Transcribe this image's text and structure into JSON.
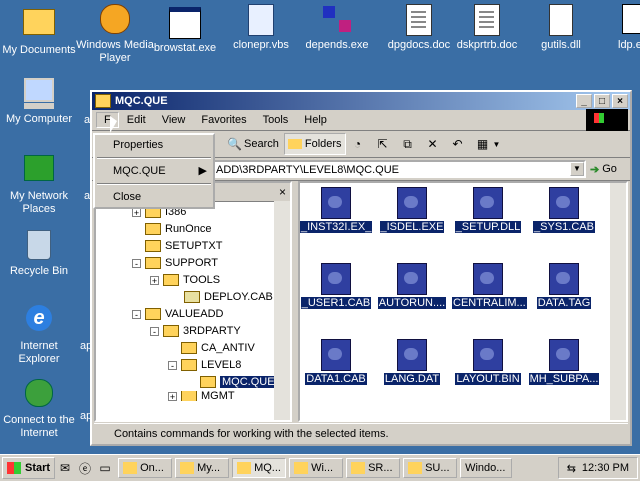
{
  "desktop": {
    "icons": [
      {
        "label": "My Documents",
        "icon": "folder-documents-icon"
      },
      {
        "label": "Windows Media Player",
        "icon": "media-player-icon"
      },
      {
        "label": "browstat.exe",
        "icon": "exe-icon"
      },
      {
        "label": "clonepr.vbs",
        "icon": "script-icon"
      },
      {
        "label": "depends.exe",
        "icon": "exe-icon"
      },
      {
        "label": "dpgdocs.doc",
        "icon": "doc-icon"
      },
      {
        "label": "dskprtrb.doc",
        "icon": "doc-icon"
      },
      {
        "label": "gutils.dll",
        "icon": "dll-icon"
      },
      {
        "label": "ldp.e",
        "icon": "exe-icon"
      },
      {
        "label": "My Computer",
        "icon": "computer-icon"
      },
      {
        "label": "My Network Places",
        "icon": "network-icon"
      },
      {
        "label": "Recycle Bin",
        "icon": "recycle-bin-icon"
      },
      {
        "label": "Internet Explorer",
        "icon": "ie-icon"
      },
      {
        "label": "Connect to the Internet",
        "icon": "connect-icon"
      }
    ],
    "partial_labels": [
      "a",
      "a",
      "ap",
      "ap"
    ]
  },
  "window": {
    "title": "MQC.QUE",
    "menu": [
      "F",
      "Edit",
      "View",
      "Favorites",
      "Tools",
      "Help"
    ],
    "toolbar": {
      "search": "Search",
      "folders": "Folders"
    },
    "address": "ADD\\3RDPARTY\\LEVEL8\\MQC.QUE",
    "go": "Go",
    "status": "Contains commands for working with the selected items."
  },
  "popup_menu": {
    "items": [
      "Properties",
      "MQC.QUE",
      "Close"
    ]
  },
  "tree": [
    {
      "label": "I386",
      "expander": "+"
    },
    {
      "label": "RunOnce",
      "expander": ""
    },
    {
      "label": "SETUPTXT",
      "expander": ""
    },
    {
      "label": "SUPPORT",
      "expander": "-"
    },
    {
      "label": "TOOLS",
      "expander": "+"
    },
    {
      "label": "DEPLOY.CAB",
      "expander": ""
    },
    {
      "label": "VALUEADD",
      "expander": "-"
    },
    {
      "label": "3RDPARTY",
      "expander": "-"
    },
    {
      "label": "CA_ANTIV",
      "expander": ""
    },
    {
      "label": "LEVEL8",
      "expander": "-"
    },
    {
      "label": "MQC.QUE",
      "expander": ""
    },
    {
      "label": "MGMT",
      "expander": "+"
    }
  ],
  "files": [
    "_INST32I.EX_",
    "_ISDEL.EXE",
    "_SETUP.DLL",
    "_SYS1.CAB",
    "_USER1.CAB",
    "AUTORUN....",
    "CENTRALIM...",
    "DATA.TAG",
    "DATA1.CAB",
    "LANG.DAT",
    "LAYOUT.BIN",
    "MH_SUBPA..."
  ],
  "taskbar": {
    "start": "Start",
    "buttons": [
      "On...",
      "My...",
      "MQ...",
      "Wi...",
      "SR...",
      "SU...",
      "Windo..."
    ],
    "clock": "12:30 PM"
  },
  "colors": {
    "desktop": "#3a6ea5",
    "selection": "#0a246a",
    "face": "#d4d0c8"
  }
}
